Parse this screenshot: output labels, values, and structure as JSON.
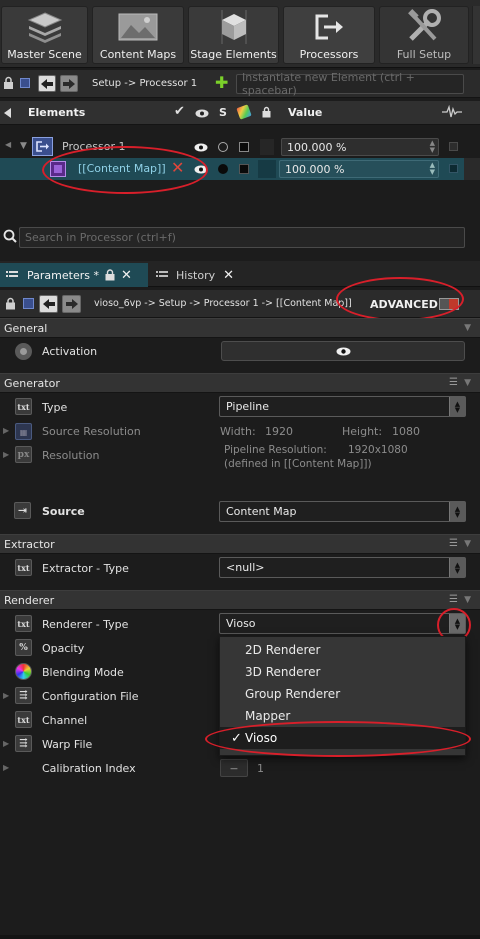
{
  "toolbar": {
    "buttons": [
      {
        "label": "Master Scene"
      },
      {
        "label": "Content Maps"
      },
      {
        "label": "Stage Elements"
      },
      {
        "label": "Processors"
      },
      {
        "label": "Full Setup"
      }
    ]
  },
  "nav": {
    "path": "Setup -> Processor 1",
    "instantiate_placeholder": "Instantiate new Element (ctrl + spacebar)"
  },
  "elements": {
    "header_label": "Elements",
    "col_s": "S",
    "value_header": "Value",
    "rows": [
      {
        "name": "Processor 1",
        "value": "100.000 %"
      },
      {
        "name": "[[Content Map]]",
        "value": "100.000 %"
      }
    ]
  },
  "search": {
    "placeholder": "Search in Processor (ctrl+f)"
  },
  "tabs": {
    "parameters": "Parameters *",
    "history": "History"
  },
  "param_nav": {
    "path": "vioso_6vp -> Setup -> Processor 1 -> [[Content Map]]",
    "advanced": "ADVANCED"
  },
  "general": {
    "title": "General",
    "activation": "Activation"
  },
  "generator": {
    "title": "Generator",
    "type_label": "Type",
    "type_value": "Pipeline",
    "source_res_label": "Source Resolution",
    "width_label": "Width:",
    "width_value": "1920",
    "height_label": "Height:",
    "height_value": "1080",
    "resolution_label": "Resolution",
    "pipeline_res_label": "Pipeline Resolution:",
    "pipeline_res_value": "1920x1080",
    "defined_in": "(defined in [[Content Map]])",
    "source_label": "Source",
    "source_value": "Content Map"
  },
  "extractor": {
    "title": "Extractor",
    "type_label": "Extractor - Type",
    "type_value": "<null>"
  },
  "renderer": {
    "title": "Renderer",
    "type_label": "Renderer - Type",
    "type_value": "Vioso",
    "params": [
      "Opacity",
      "Blending Mode",
      "Configuration File",
      "Channel",
      "Warp File",
      "Calibration Index"
    ],
    "calibration_value": "1",
    "dropdown_options": [
      "2D Renderer",
      "3D Renderer",
      "Group Renderer",
      "Mapper",
      "Vioso"
    ],
    "selected_option": "Vioso",
    "checkmark": "✓"
  },
  "colors": {
    "accent_teal": "#1f4a55",
    "annotation_red": "#d81f2a",
    "cross_red": "#e0463a"
  }
}
